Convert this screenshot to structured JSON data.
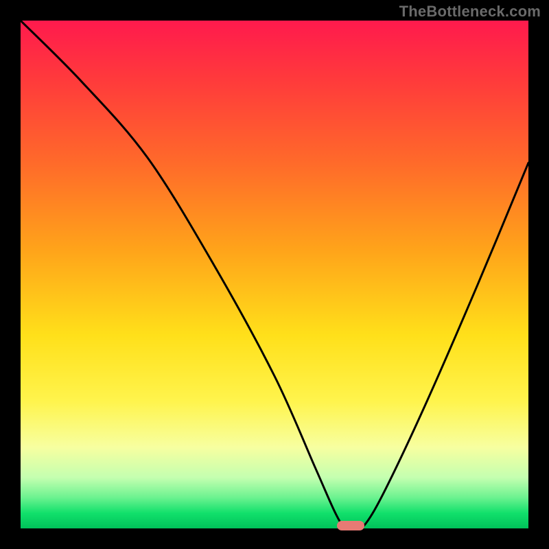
{
  "watermark": "TheBottleneck.com",
  "colors": {
    "frame": "#000000",
    "marker": "#e77a74",
    "curve": "#000000"
  },
  "chart_data": {
    "type": "line",
    "title": "",
    "xlabel": "",
    "ylabel": "",
    "xlim": [
      0,
      100
    ],
    "ylim": [
      0,
      100
    ],
    "grid": false,
    "legend": false,
    "series": [
      {
        "name": "curve",
        "x": [
          0,
          12,
          25,
          38,
          50,
          58,
          62,
          64,
          66,
          68,
          72,
          80,
          90,
          100
        ],
        "y": [
          100,
          88,
          73,
          52,
          30,
          12,
          3,
          0,
          0,
          1,
          8,
          25,
          48,
          72
        ]
      }
    ],
    "marker": {
      "x": 65,
      "y": 0,
      "shape": "pill"
    },
    "gradient_bands": [
      {
        "pos": 0.0,
        "color": "#ff1a4d"
      },
      {
        "pos": 0.12,
        "color": "#ff3b3b"
      },
      {
        "pos": 0.28,
        "color": "#ff6a2a"
      },
      {
        "pos": 0.45,
        "color": "#ffa31a"
      },
      {
        "pos": 0.62,
        "color": "#ffe01a"
      },
      {
        "pos": 0.75,
        "color": "#fff44d"
      },
      {
        "pos": 0.84,
        "color": "#f7ffa0"
      },
      {
        "pos": 0.9,
        "color": "#c4ffb0"
      },
      {
        "pos": 0.94,
        "color": "#6af28f"
      },
      {
        "pos": 0.97,
        "color": "#11e06b"
      },
      {
        "pos": 1.0,
        "color": "#00c25a"
      }
    ]
  }
}
